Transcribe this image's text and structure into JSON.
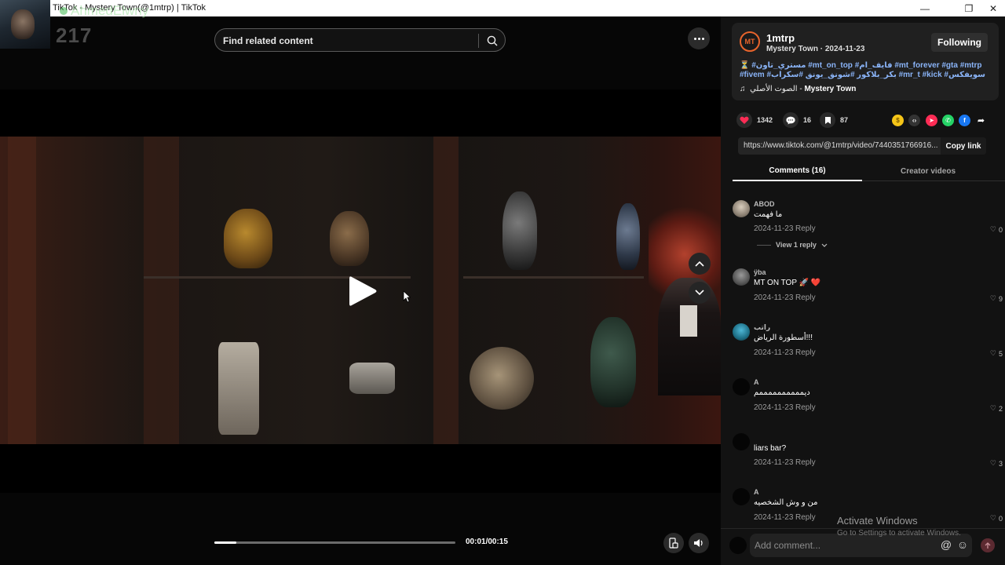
{
  "window": {
    "title": "TikTok - Mystery Town(@1mtrp) | TikTok",
    "minimize": "—",
    "restore": "❐",
    "close": "✕"
  },
  "overlay": {
    "streamer_name": "AhmedElwny",
    "count": "217"
  },
  "search": {
    "placeholder": "Find related content"
  },
  "player": {
    "time": "00:01/00:15",
    "progress_fraction": 0.09
  },
  "post": {
    "avatar_text": "MT",
    "username": "1mtrp",
    "nickname_date": "Mystery Town · 2024-11-23",
    "follow_label": "Following",
    "caption": "⏳ #مستري_تاون #mt_on_top #فايف_ام #mt_forever #gta #mtrp #fivem #بكر_بلاكور #شونق_يونق #سكراب #mr_t #kick #سويفكس",
    "sound_prefix": "الصوت الأصلي - ",
    "sound_author": "Mystery Town"
  },
  "stats": {
    "likes": "1342",
    "comments": "16",
    "saves": "87"
  },
  "link": {
    "url": "https://www.tiktok.com/@1mtrp/video/7440351766916...",
    "copy_label": "Copy link"
  },
  "tabs": {
    "comments": "Comments (16)",
    "creator_videos": "Creator videos"
  },
  "comments": [
    {
      "user": "ABOD",
      "text": "ما فهمت",
      "date": "2024-11-23",
      "reply": "Reply",
      "likes": "0"
    },
    {
      "user": "ÿba",
      "text": "MT ON TOP 🚀 ❤️",
      "date": "2024-11-23",
      "reply": "Reply",
      "likes": "9"
    },
    {
      "user": "راتب",
      "text": "أسطورة الرياض!!!",
      "date": "2024-11-23",
      "reply": "Reply",
      "likes": "5"
    },
    {
      "user": "A",
      "text": "ديممممممممممم",
      "date": "2024-11-23",
      "reply": "Reply",
      "likes": "2"
    },
    {
      "user": "",
      "text": "liars bar?",
      "date": "2024-11-23",
      "reply": "Reply",
      "likes": "3"
    },
    {
      "user": "A",
      "text": "من و وش الشخصيه",
      "date": "2024-11-23",
      "reply": "Reply",
      "likes": "0"
    }
  ],
  "view_replies": "View 1 reply",
  "composer": {
    "placeholder": "Add comment...",
    "mention": "@",
    "emoji": "☺"
  },
  "watermark": {
    "title": "Activate Windows",
    "subtitle": "Go to Settings to activate Windows."
  }
}
